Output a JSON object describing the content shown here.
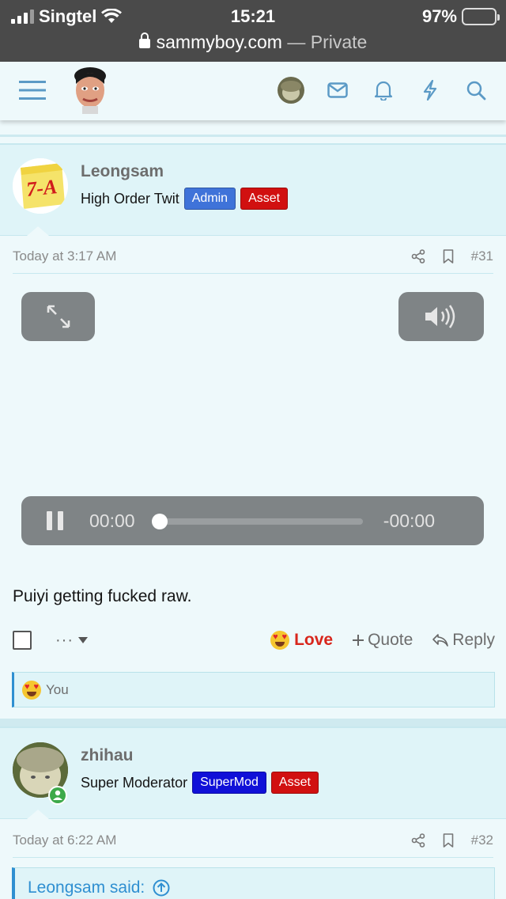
{
  "status_bar": {
    "carrier": "Singtel",
    "time": "15:21",
    "battery": "97%",
    "battery_level": 0.97,
    "url_host": "sammyboy.com",
    "url_suffix": "— Private"
  },
  "navbar": {
    "icons": [
      "menu-icon",
      "logo-avatar",
      "user-avatar",
      "mail-icon",
      "bell-icon",
      "bolt-icon",
      "search-icon"
    ]
  },
  "posts": [
    {
      "username": "Leongsam",
      "user_title": "High Order Twit",
      "badges": [
        {
          "label": "Admin",
          "color": "#3f73d9"
        },
        {
          "label": "Asset",
          "color": "#d11010"
        }
      ],
      "avatar_text": "7-A",
      "timestamp": "Today at 3:17 AM",
      "post_number": "#31",
      "video": {
        "elapsed": "00:00",
        "remaining": "-00:00",
        "progress": 0
      },
      "message": "Puiyi getting fucked raw.",
      "more_label": "···",
      "actions": {
        "love": "Love",
        "quote": "Quote",
        "reply": "Reply"
      },
      "reactions_text": "You"
    },
    {
      "username": "zhihau",
      "user_title": "Super Moderator",
      "badges": [
        {
          "label": "SuperMod",
          "color": "#1010d8"
        },
        {
          "label": "Asset",
          "color": "#d11010"
        }
      ],
      "timestamp": "Today at 6:22 AM",
      "post_number": "#32",
      "quote_label": "Leongsam said:"
    }
  ],
  "colors": {
    "accent": "#2f8fd1",
    "love": "#d8261c",
    "page_bg": "#eef9fb",
    "header_bg": "#dff4f8"
  }
}
